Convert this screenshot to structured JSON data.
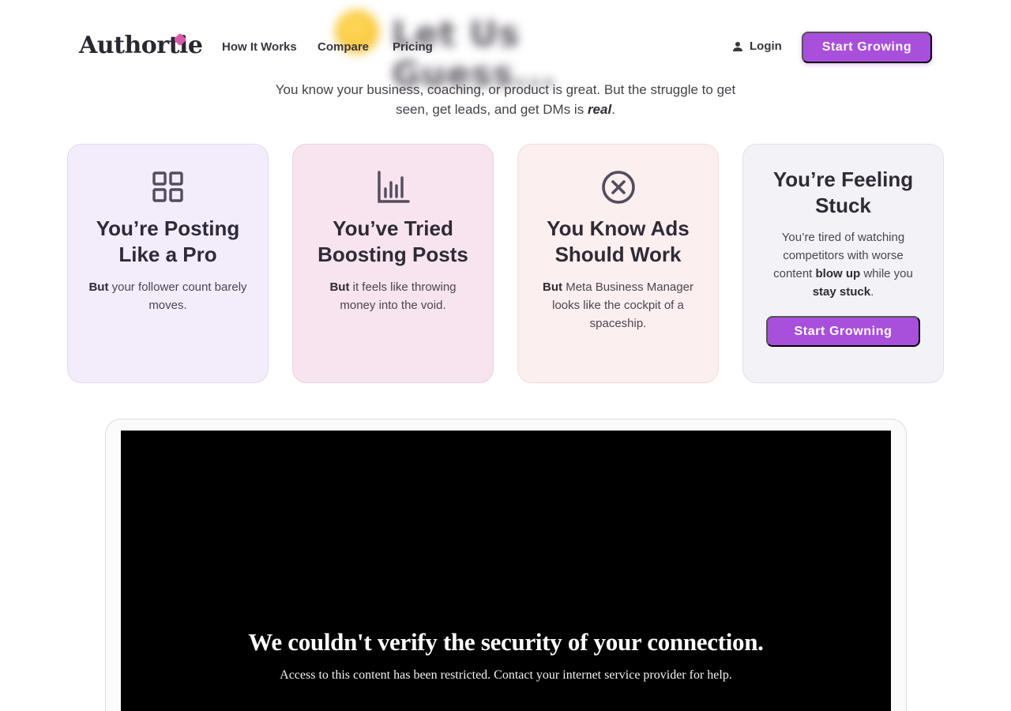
{
  "hero": {
    "blurred_heading": "Let Us Guess..."
  },
  "nav": {
    "logo": "Authortie",
    "links": [
      "How It Works",
      "Compare",
      "Pricing"
    ],
    "login": "Login",
    "cta": "Start Growing"
  },
  "intro": {
    "line1": "You know your business, coaching, or product is great. But the struggle to get",
    "line2": "seen, get leads, and get DMs is ",
    "emphasis": "real",
    "end": "."
  },
  "cards": [
    {
      "icon": "grid-icon",
      "title": "You’re Posting Like a Pro",
      "lead": "But",
      "text": " your follower count barely moves."
    },
    {
      "icon": "bar-chart-icon",
      "title": "You’ve Tried Boosting Posts",
      "lead": "But",
      "text": " it feels like throwing money into the void."
    },
    {
      "icon": "x-circle-icon",
      "title": "You Know Ads Should Work",
      "lead": "But",
      "text": " Meta Business Manager looks like the cockpit of a spaceship."
    },
    {
      "title": "You’re Feeling Stuck",
      "t1": "You’re tired of watching competitors with worse content ",
      "b1": "blow up",
      "t2": " while you ",
      "b2": "stay stuck",
      "t3": ".",
      "cta": "Start Growning"
    }
  ],
  "video": {
    "error_title": "We couldn't verify the security of your connection.",
    "error_message": "Access to this content has been restricted. Contact your internet service provider for help."
  },
  "colors": {
    "accent": "#a84fdc",
    "text": "#2f2b36"
  }
}
